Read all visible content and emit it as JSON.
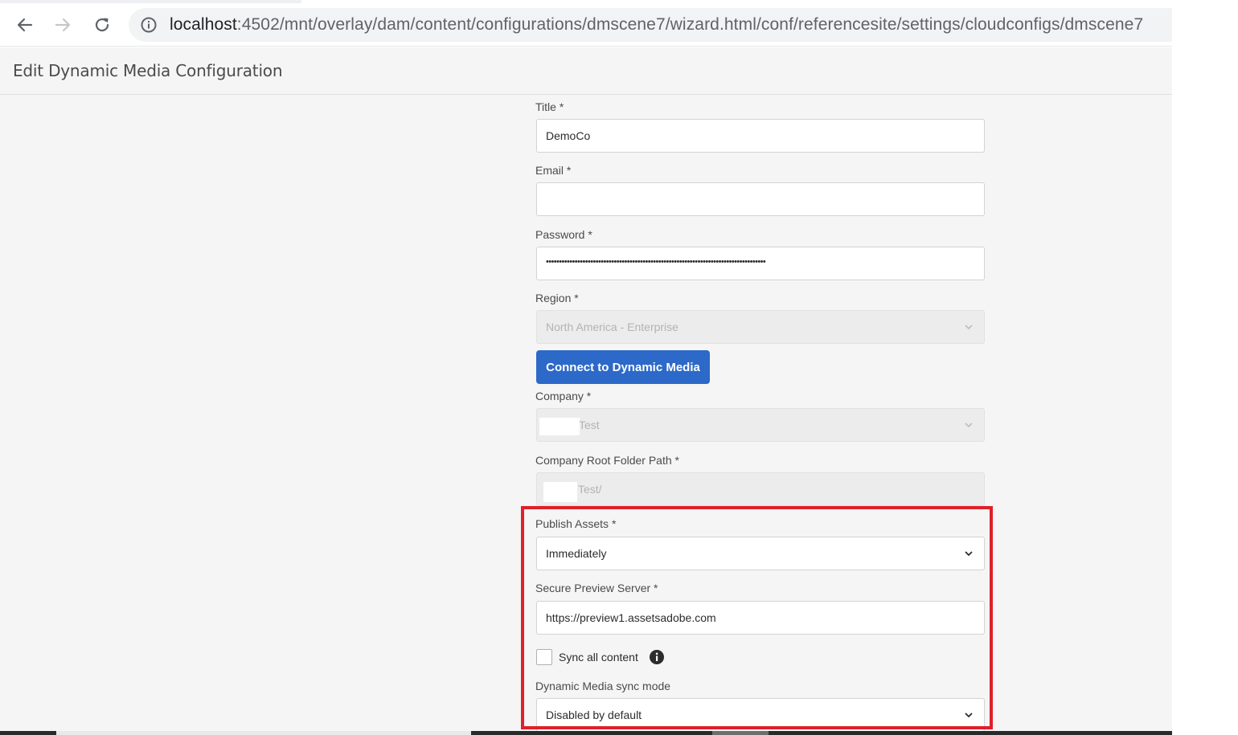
{
  "browser": {
    "url_host": "localhost",
    "url_path": ":4502/mnt/overlay/dam/content/configurations/dmscene7/wizard.html/conf/referencesite/settings/cloudconfigs/dmscene7"
  },
  "header": {
    "title": "Edit Dynamic Media Configuration"
  },
  "form": {
    "title_label": "Title *",
    "title_value": "DemoCo",
    "email_label": "Email *",
    "email_value": "",
    "password_label": "Password *",
    "password_value": "••••••••••••••••••••••••••••••••••••••••••••••••••••••••••••••••••••••••••••••••••••",
    "region_label": "Region *",
    "region_value": "North America - Enterprise",
    "connect_button": "Connect to Dynamic Media",
    "company_label": "Company *",
    "company_value": "Test",
    "root_path_label": "Company Root Folder Path *",
    "root_path_value": "Test/",
    "publish_label": "Publish Assets *",
    "publish_value": "Immediately",
    "preview_label": "Secure Preview Server *",
    "preview_value": "https://preview1.assetsadobe.com",
    "sync_all_label": "Sync all content",
    "sync_all_checked": false,
    "sync_mode_label": "Dynamic Media sync mode",
    "sync_mode_value": "Disabled by default"
  },
  "colors": {
    "primary_button": "#2c69c8",
    "highlight_border": "#e0202a",
    "page_bg": "#f5f5f5"
  },
  "icons": {
    "back": "arrow-left-icon",
    "forward": "arrow-right-icon",
    "reload": "reload-icon",
    "site_info": "info-circle-icon",
    "dropdown": "chevron-down-icon",
    "sync_info": "info-filled-icon"
  }
}
